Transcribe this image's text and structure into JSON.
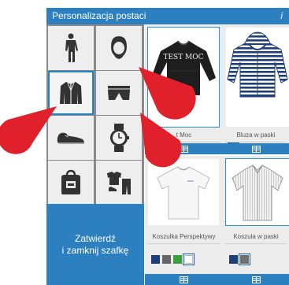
{
  "window": {
    "title": "Personalizacja postaci",
    "info_glyph": "i",
    "edge_glyph": "▸"
  },
  "categories": [
    {
      "name": "cat-body",
      "icon": "body-icon",
      "selected": false
    },
    {
      "name": "cat-head",
      "icon": "head-icon",
      "selected": false
    },
    {
      "name": "cat-jacket",
      "icon": "jacket-icon",
      "selected": true
    },
    {
      "name": "cat-underwear",
      "icon": "underwear-icon",
      "selected": false
    },
    {
      "name": "cat-shoes",
      "icon": "shoes-icon",
      "selected": false
    },
    {
      "name": "cat-watch",
      "icon": "watch-icon",
      "selected": false
    },
    {
      "name": "cat-bag",
      "icon": "bag-icon",
      "selected": false
    },
    {
      "name": "cat-outfit",
      "icon": "outfit-icon",
      "selected": false
    }
  ],
  "confirm": {
    "line1": "Zatwierdź",
    "line2": "i zamknij szafkę"
  },
  "products": [
    {
      "name": "t Moc",
      "image_text": "TEST MOC",
      "selected": true,
      "swatches": [
        "#2a2a2a",
        "#888888",
        "#3aa040",
        "#ffffff"
      ],
      "selected_swatch": 0
    },
    {
      "name": "Bluza w paski",
      "selected": false,
      "swatches": [
        "#1f3f7a",
        "#707070"
      ],
      "selected_swatch": 0
    },
    {
      "name": "Koszulka Perspektywy",
      "selected": false,
      "swatches": [
        "#1f3f7a",
        "#666666",
        "#3aa040",
        "#ffffff"
      ],
      "selected_swatch": 3
    },
    {
      "name": "Koszula w paski",
      "selected": true,
      "swatches": [
        "#1f3f7a",
        "#707070"
      ],
      "selected_swatch": 1
    }
  ],
  "colors": {
    "accent": "#2c80c0",
    "pointer": "#e0202a"
  }
}
